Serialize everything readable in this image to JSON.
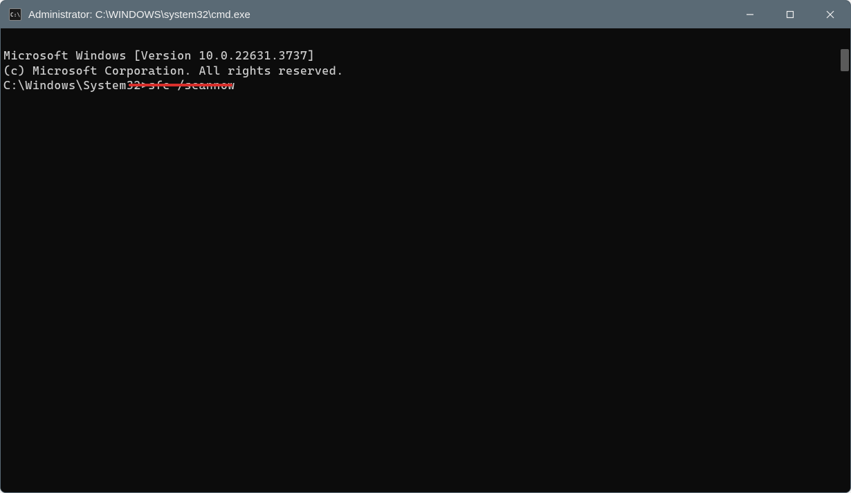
{
  "titlebar": {
    "icon_label": "C:\\",
    "title": "Administrator: C:\\WINDOWS\\system32\\cmd.exe"
  },
  "window_controls": {
    "minimize_glyph": "—",
    "maximize_glyph": "☐",
    "close_glyph": "✕"
  },
  "terminal": {
    "line1": "Microsoft Windows [Version 10.0.22631.3737]",
    "line2": "(c) Microsoft Corporation. All rights reserved.",
    "blank": "",
    "prompt": "C:\\Windows\\System32>",
    "command": "sfc /scannow"
  },
  "annotation": {
    "underline_color": "#d9302c"
  }
}
